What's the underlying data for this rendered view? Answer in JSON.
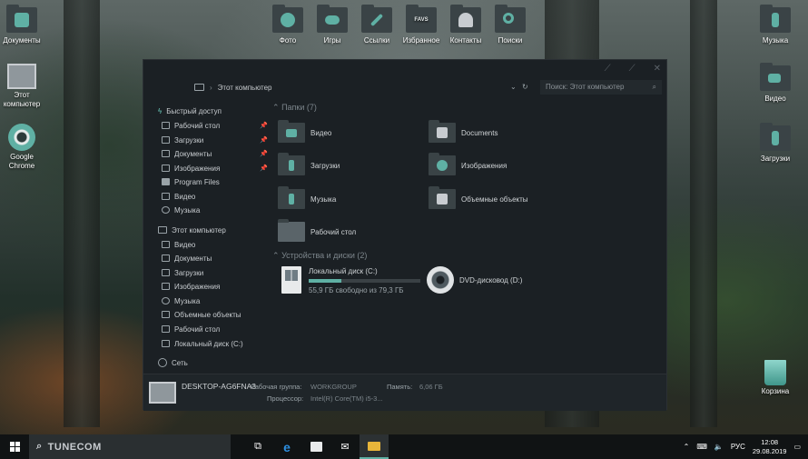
{
  "desktop": {
    "left_icons": [
      {
        "label": "Документы",
        "icon": "documents-folder-icon"
      },
      {
        "label": "Этот компьютер",
        "icon": "this-pc-icon"
      },
      {
        "label": "Google Chrome",
        "icon": "chrome-icon"
      }
    ],
    "top_icons": [
      {
        "label": "Фото",
        "icon": "camera-icon"
      },
      {
        "label": "Игры",
        "icon": "gamepad-icon"
      },
      {
        "label": "Ссылки",
        "icon": "link-icon"
      },
      {
        "label": "Избранное",
        "icon": "favs-icon",
        "badge": "FAVS"
      },
      {
        "label": "Контакты",
        "icon": "contacts-icon"
      },
      {
        "label": "Поиски",
        "icon": "search-folder-icon"
      }
    ],
    "right_icons": [
      {
        "label": "Музыка",
        "icon": "music-folder-icon"
      },
      {
        "label": "Видео",
        "icon": "video-folder-icon"
      },
      {
        "label": "Загрузки",
        "icon": "downloads-folder-icon"
      },
      {
        "label": "Корзина",
        "icon": "recycle-bin-icon"
      }
    ]
  },
  "explorer": {
    "address": "Этот компьютер",
    "search_placeholder": "Поиск: Этот компьютер",
    "nav": {
      "quick_access": "Быстрый доступ",
      "quick_items": [
        "Рабочий стол",
        "Загрузки",
        "Документы",
        "Изображения",
        "Program Files",
        "Видео",
        "Музыка"
      ],
      "this_pc": "Этот компьютер",
      "pc_items": [
        "Видео",
        "Документы",
        "Загрузки",
        "Изображения",
        "Музыка",
        "Объемные объекты",
        "Рабочий стол",
        "Локальный диск (C:)"
      ],
      "network": "Сеть"
    },
    "folders_header": "Папки (7)",
    "folders": [
      "Видео",
      "Documents",
      "Загрузки",
      "Изображения",
      "Музыка",
      "Объемные объекты",
      "Рабочий стол"
    ],
    "devices_header": "Устройства и диски (2)",
    "drive_c": {
      "name": "Локальный диск (C:)",
      "free": "55,9 ГБ свободно из 79,3 ГБ",
      "used_fraction": 0.295
    },
    "dvd": {
      "name": "DVD-дисковод (D:)"
    },
    "details": {
      "pc_name": "DESKTOP-AG6FNA3",
      "workgroup_label": "Рабочая группа:",
      "workgroup": "WORKGROUP",
      "memory_label": "Память:",
      "memory": "6,06 ГБ",
      "cpu_label": "Процессор:",
      "cpu": "Intel(R) Core(TM) i5-3..."
    }
  },
  "taskbar": {
    "search_text": "TUNECOM",
    "tray_lang": "РУС",
    "time": "12:08",
    "date": "29.08.2019"
  },
  "colors": {
    "accent": "#5fb0a4",
    "window_bg": "#1b2024",
    "taskbar": "#101314"
  }
}
